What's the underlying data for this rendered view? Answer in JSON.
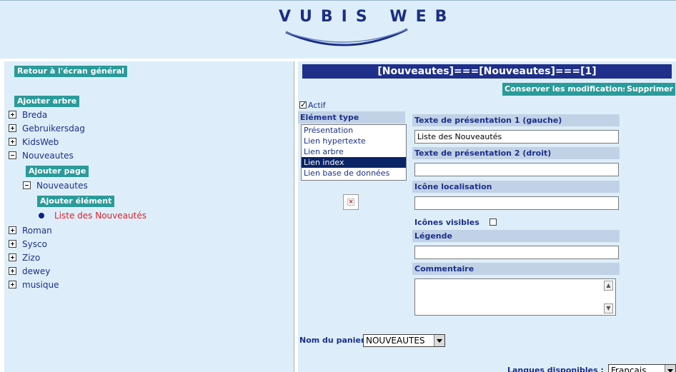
{
  "banner": {
    "logo_text": "VUBIS WEB"
  },
  "left": {
    "back_button": "Retour à l'écran général",
    "add_tree_button": "Ajouter arbre",
    "add_page_button": "Ajouter page",
    "add_element_button": "Ajouter élément",
    "tree": [
      {
        "label": "Breda",
        "expanded": false
      },
      {
        "label": "Gebruikersdag",
        "expanded": false
      },
      {
        "label": "KidsWeb",
        "expanded": false
      },
      {
        "label": "Nouveautes",
        "expanded": true
      },
      {
        "label": "Nouveautes",
        "expanded": true
      },
      {
        "label": "Liste des Nouveautés",
        "leaf": true
      },
      {
        "label": "Roman",
        "expanded": false
      },
      {
        "label": "Sysco",
        "expanded": false
      },
      {
        "label": "Zizo",
        "expanded": false
      },
      {
        "label": "dewey",
        "expanded": false
      },
      {
        "label": "musique",
        "expanded": false
      }
    ]
  },
  "right": {
    "title": "[Nouveautes]===[Nouveautes]===[1]",
    "save_button": "Conserver les modifications",
    "delete_button": "Supprimer",
    "actif_label": "Actif",
    "actif_checked": true,
    "element_type_label": "Elément type",
    "element_types": [
      "Présentation",
      "Lien hypertexte",
      "Lien arbre",
      "Lien index",
      "Lien base de données"
    ],
    "element_type_selected": "Lien index",
    "text1_label": "Texte de présentation 1 (gauche)",
    "text1_value": "Liste des Nouveautés",
    "text2_label": "Texte de présentation 2 (droit)",
    "text2_value": "",
    "icon_loc_label": "Icône localisation",
    "icon_loc_value": "",
    "icons_visible_label": "Icônes visibles",
    "icons_visible_checked": false,
    "legend_label": "Légende",
    "legend_value": "",
    "comment_label": "Commentaire",
    "comment_value": "",
    "basket_label": "Nom du panier",
    "basket_value": "NOUVEAUTES",
    "languages_label": "Langues disponibles :",
    "language_value": "Français"
  },
  "colors": {
    "panel_bg": "#ddeefa",
    "title_bg": "#1f2f8a",
    "button_teal": "#2b9a9a",
    "link_blue": "#1b2f8c",
    "selected_red": "#e0202a"
  }
}
